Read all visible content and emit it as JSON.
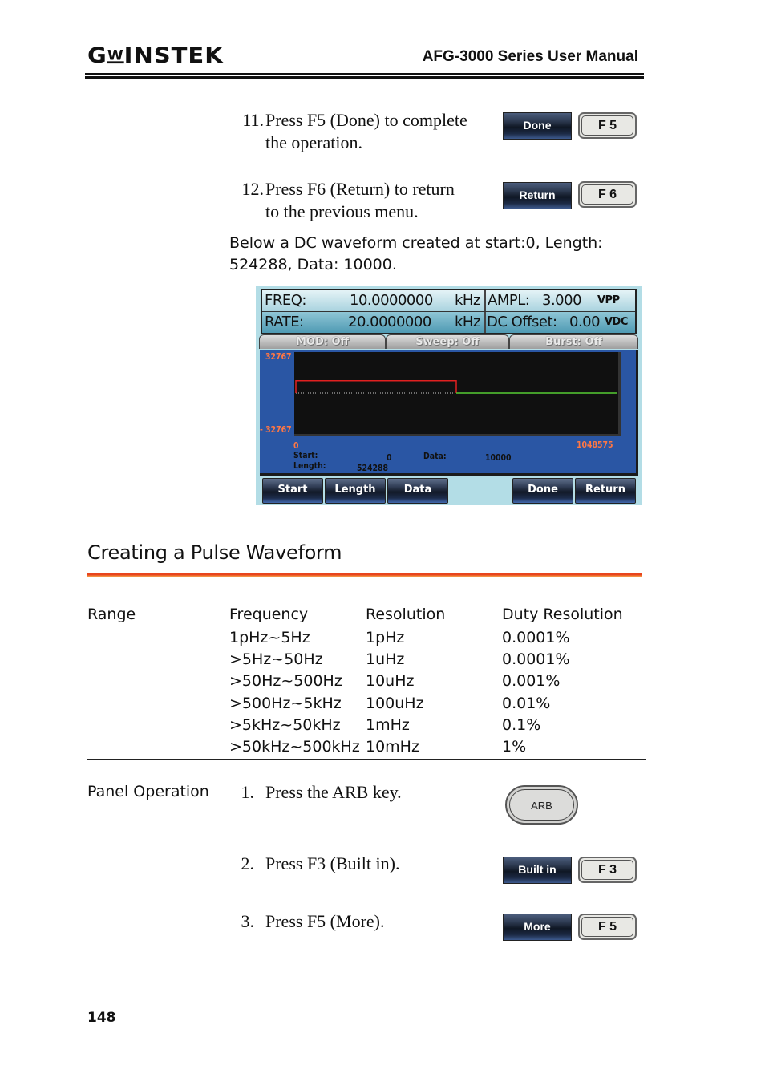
{
  "header": {
    "brand": "GW INSTEK",
    "brand_parts": [
      "G",
      "W",
      "INSTEK"
    ],
    "manual_title": "AFG-3000 Series User Manual"
  },
  "top_steps": [
    {
      "number": "11.",
      "line1": "Press F5 (Done) to complete",
      "line2": "the operation.",
      "softkey": "Done",
      "fkey": "F 5"
    },
    {
      "number": "12.",
      "line1": "Press F6 (Return) to return",
      "line2": "to the previous menu.",
      "softkey": "Return",
      "fkey": "F 6"
    }
  ],
  "caption": {
    "line1": "Below a DC waveform created at start:0, Length:",
    "line2": "524288, Data: 10000."
  },
  "screen": {
    "freq_label": "FREQ:",
    "freq_value": "10.0000000",
    "freq_unit": "kHz",
    "ampl_label": "AMPL:",
    "ampl_value": "3.000",
    "ampl_unit": "VPP",
    "rate_label": "RATE:",
    "rate_value": "20.0000000",
    "rate_unit": "kHz",
    "offset_label": "DC Offset:",
    "offset_value": "0.00",
    "offset_unit": "VDC",
    "tabs": [
      "MOD: Off",
      "Sweep: Off",
      "Burst: Off"
    ],
    "y_max_label": "32767",
    "y_min_label": "- 32767",
    "x_min_label": "0",
    "x_max_label": "1048575",
    "start_label": "Start:",
    "start_value": "0",
    "length_label": "Length:",
    "length_value": "524288",
    "data_label": "Data:",
    "data_value": "10000",
    "waveform": {
      "y_range": [
        -32767,
        32767
      ],
      "x_range": [
        0,
        1048575
      ],
      "edited_segment": {
        "start": 0,
        "length": 524288,
        "value": 10000,
        "color": "#e02020"
      },
      "rest_value": 0,
      "rest_color": "#55cc33"
    },
    "menu_buttons": [
      "Start",
      "Length",
      "Data",
      "",
      "Done",
      "Return"
    ]
  },
  "section": {
    "title": "Creating a Pulse Waveform"
  },
  "range_table": {
    "row_label": "Range",
    "headers": [
      "Frequency",
      "Resolution",
      "Duty Resolution"
    ],
    "rows": [
      [
        "1pHz~5Hz",
        "1pHz",
        "0.0001%"
      ],
      [
        ">5Hz~50Hz",
        "1uHz",
        "0.0001%"
      ],
      [
        ">50Hz~500Hz",
        "10uHz",
        "0.001%"
      ],
      [
        ">500Hz~5kHz",
        "100uHz",
        "0.01%"
      ],
      [
        ">5kHz~50kHz",
        "1mHz",
        "0.1%"
      ],
      [
        ">50kHz~500kHz",
        "10mHz",
        "1%"
      ]
    ]
  },
  "panel_operation": {
    "label": "Panel Operation",
    "steps": [
      {
        "number": "1.",
        "text": "Press the ARB key.",
        "key": "ARB"
      },
      {
        "number": "2.",
        "text": "Press F3 (Built in).",
        "softkey": "Built in",
        "fkey": "F 3"
      },
      {
        "number": "3.",
        "text": "Press F5 (More).",
        "softkey": "More",
        "fkey": "F 5"
      }
    ]
  },
  "footer": {
    "page_number": "148"
  }
}
